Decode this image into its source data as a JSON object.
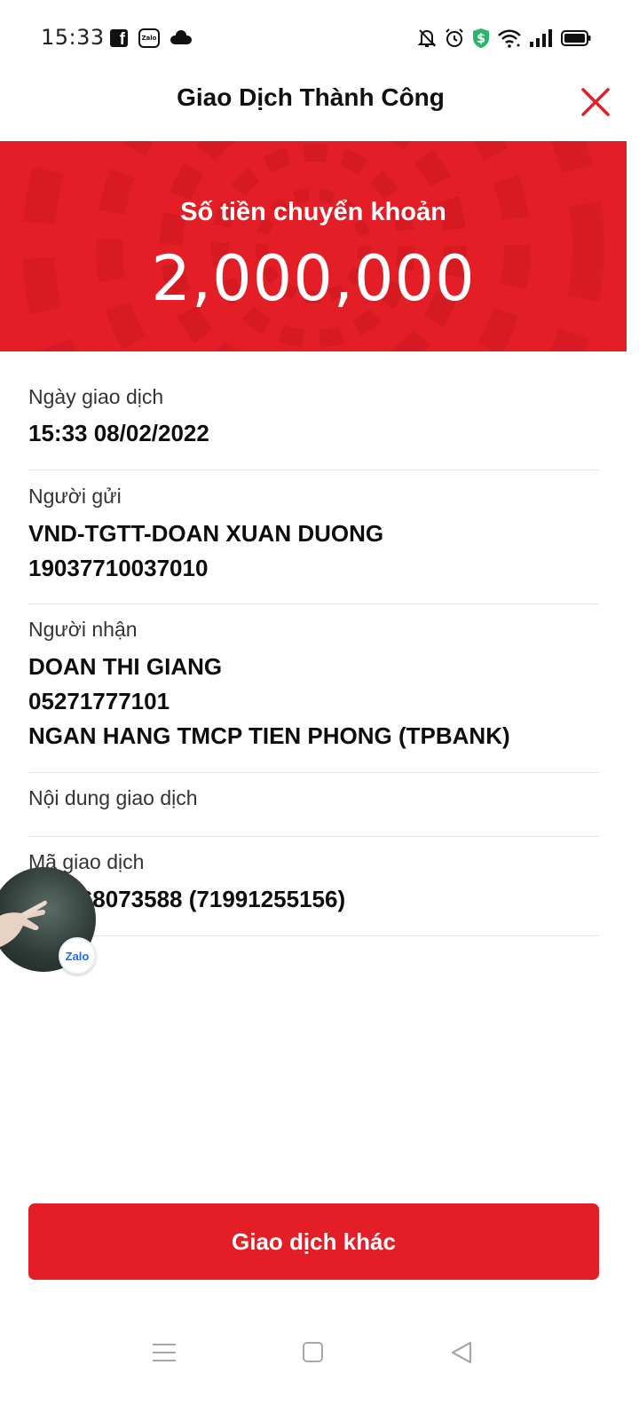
{
  "status_bar": {
    "time": "15:33",
    "left_icons": [
      "facebook-icon",
      "zalo-icon",
      "cloud-icon"
    ],
    "zalo_text": "Zalo",
    "right_icons": [
      "bell-off-icon",
      "alarm-icon",
      "shield-dollar-icon",
      "wifi-icon",
      "signal-icon",
      "battery-icon"
    ],
    "shield_color": "#2db36b"
  },
  "header": {
    "title": "Giao Dịch Thành Công",
    "close_icon": "close-icon",
    "close_color": "#e41e26"
  },
  "banner": {
    "label": "Số tiền chuyển khoản",
    "amount": "2,000,000",
    "color": "#e41e26"
  },
  "details": {
    "date": {
      "label": "Ngày giao dịch",
      "value": "15:33 08/02/2022"
    },
    "sender": {
      "label": "Người gửi",
      "name": "VND-TGTT-DOAN XUAN DUONG",
      "account": "19037710037010"
    },
    "receiver": {
      "label": "Người nhận",
      "name": "DOAN THI GIANG",
      "account": "05271777101",
      "bank": "NGAN HANG TMCP TIEN PHONG (TPBANK)"
    },
    "content": {
      "label": "Nội dung giao dịch",
      "value": ""
    },
    "transaction_code": {
      "label": "Mã giao dịch",
      "value": "039468073588 (71991255156)"
    }
  },
  "floating_bubble": {
    "badge_text": "Zalo",
    "badge_color": "#1a6ef0"
  },
  "action_button": {
    "label": "Giao dịch khác"
  },
  "navbar": {
    "icons": [
      "menu-icon",
      "home-icon",
      "back-icon"
    ]
  }
}
